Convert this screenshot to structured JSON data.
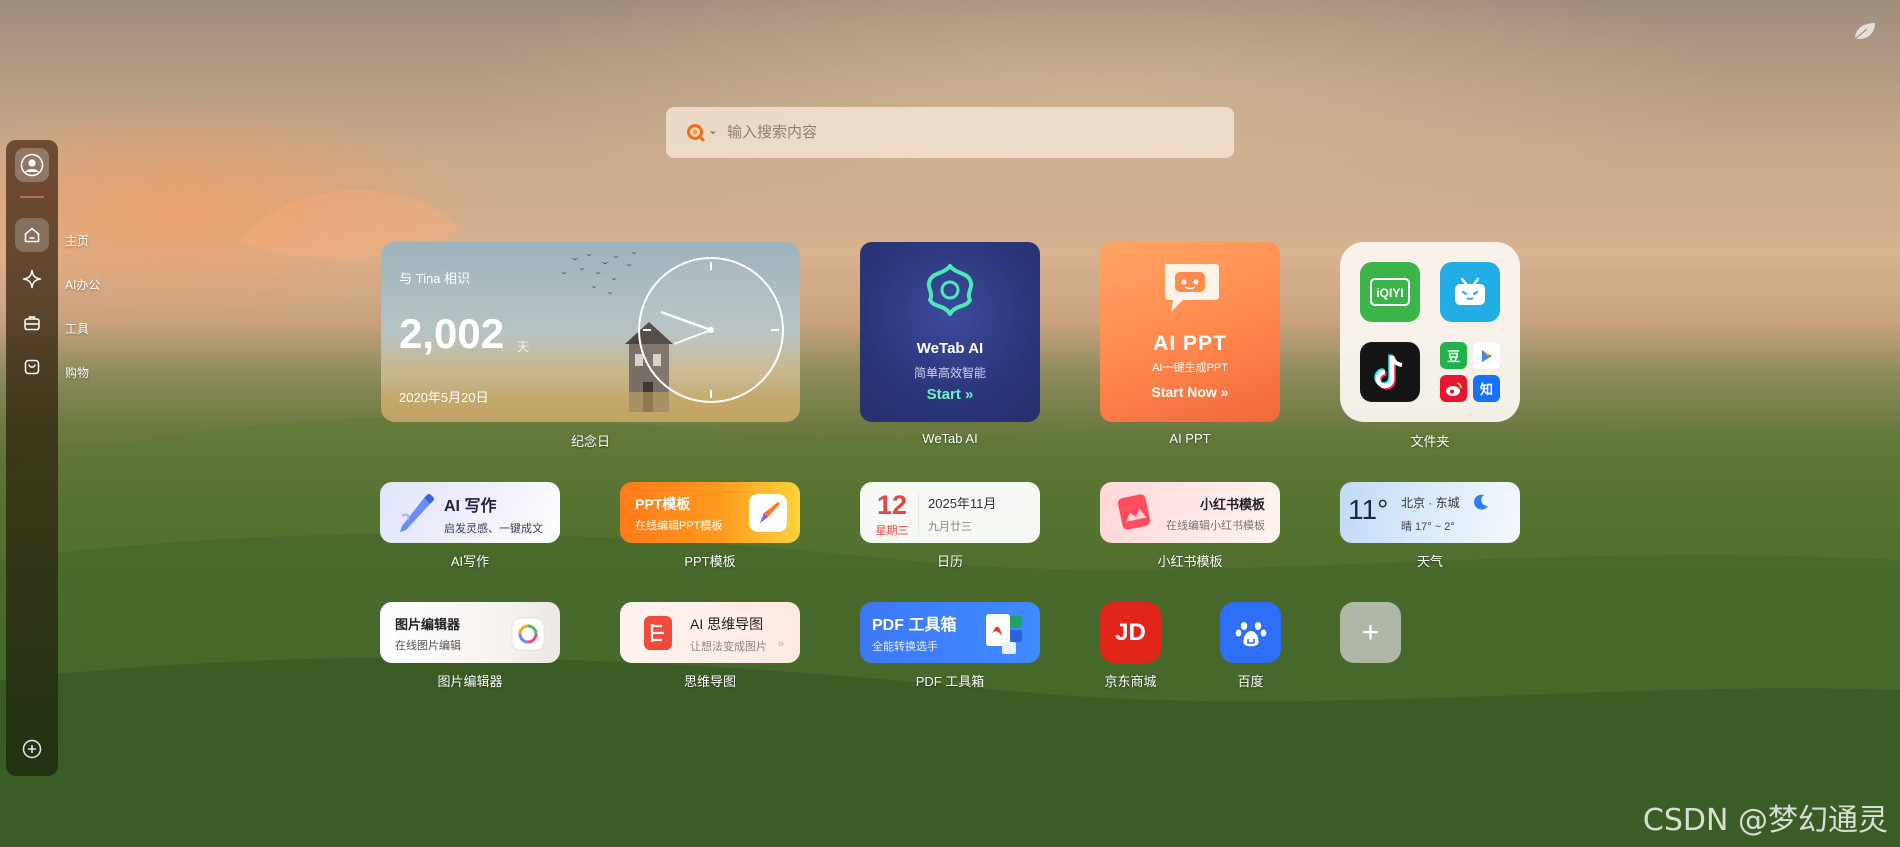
{
  "search": {
    "placeholder": "输入搜索内容"
  },
  "sidebar": {
    "items": [
      {
        "label": "主页",
        "icon": "home-icon"
      },
      {
        "label": "AI办公",
        "icon": "sparkle-icon"
      },
      {
        "label": "工具",
        "icon": "toolbox-icon"
      },
      {
        "label": "购物",
        "icon": "shopping-bag-icon"
      }
    ],
    "add_icon": "plus-circle-icon"
  },
  "widgets": {
    "anniversary": {
      "title": "与 Tina 相识",
      "days": "2,002",
      "unit": "天",
      "date": "2020年5月20日",
      "caption": "纪念日"
    },
    "wetab_ai": {
      "name": "WeTab AI",
      "slogan": "简单高效智能",
      "cta": "Start »",
      "caption": "WeTab AI"
    },
    "ai_ppt": {
      "name": "AI PPT",
      "slogan": "AI一键生成PPT",
      "cta": "Start Now »",
      "caption": "AI PPT"
    },
    "folder": {
      "caption": "文件夹",
      "apps": [
        "iQIYI",
        "bilibili",
        "TikTok",
        "豆",
        "play",
        "weibo",
        "知"
      ]
    },
    "ai_write": {
      "name": "AI 写作",
      "slogan": "启发灵感、一键成文",
      "caption": "AI写作"
    },
    "ppt_template": {
      "name": "PPT模板",
      "slogan": "在线编辑PPT模板",
      "caption": "PPT模板"
    },
    "calendar": {
      "day": "12",
      "weekday": "星期三",
      "year_month": "2025年11月",
      "lunar": "九月廿三",
      "caption": "日历"
    },
    "xhs_template": {
      "name": "小红书模板",
      "slogan": "在线编辑小红书模板",
      "caption": "小红书模板"
    },
    "weather": {
      "temp": "11°",
      "city": "北京 · 东城",
      "range": "晴 17° ~ 2°",
      "caption": "天气"
    },
    "image_editor": {
      "name": "图片编辑器",
      "slogan": "在线图片编辑",
      "caption": "图片编辑器"
    },
    "mindmap": {
      "name": "AI 思维导图",
      "slogan": "让想法变成图片",
      "more": "»",
      "caption": "思维导图"
    },
    "pdf_tool": {
      "name": "PDF 工具箱",
      "slogan": "全能转换选手",
      "caption": "PDF 工具箱"
    },
    "jd": {
      "logo": "JD",
      "caption": "京东商城"
    },
    "baidu": {
      "caption": "百度"
    },
    "add": {
      "symbol": "+"
    }
  },
  "watermark": "CSDN @梦幻通灵"
}
